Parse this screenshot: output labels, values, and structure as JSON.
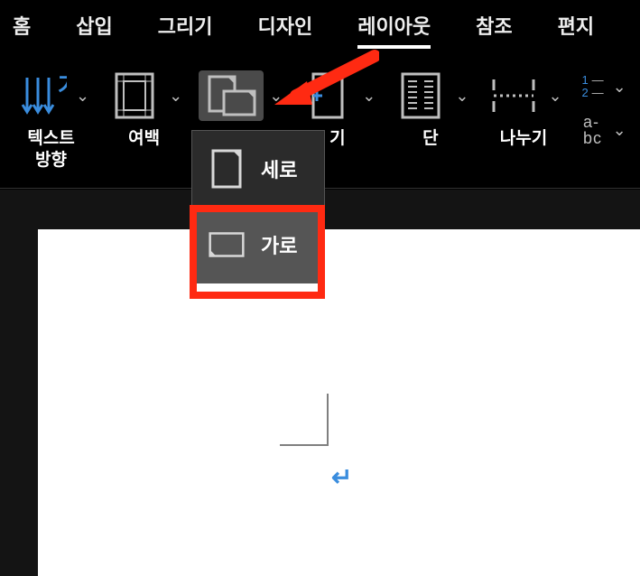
{
  "tabs": {
    "items": [
      "홈",
      "삽입",
      "그리기",
      "디자인",
      "레이아웃",
      "참조",
      "편지"
    ],
    "active_index": 4
  },
  "ribbon": {
    "groups": {
      "text_direction": {
        "label": "텍스트\n방향"
      },
      "margins": {
        "label": "여백"
      },
      "orientation": {
        "label": ""
      },
      "size": {
        "label_suffix": "기"
      },
      "columns": {
        "label": "단"
      },
      "breaks": {
        "label": "나누기"
      },
      "line_numbers": {
        "label": ""
      },
      "hyphenation": {
        "label": "a-\nbc"
      }
    }
  },
  "dropdown": {
    "items": [
      {
        "label": "세로",
        "selected": false
      },
      {
        "label": "가로",
        "selected": true
      }
    ]
  },
  "document": {
    "return_glyph": "↵"
  }
}
